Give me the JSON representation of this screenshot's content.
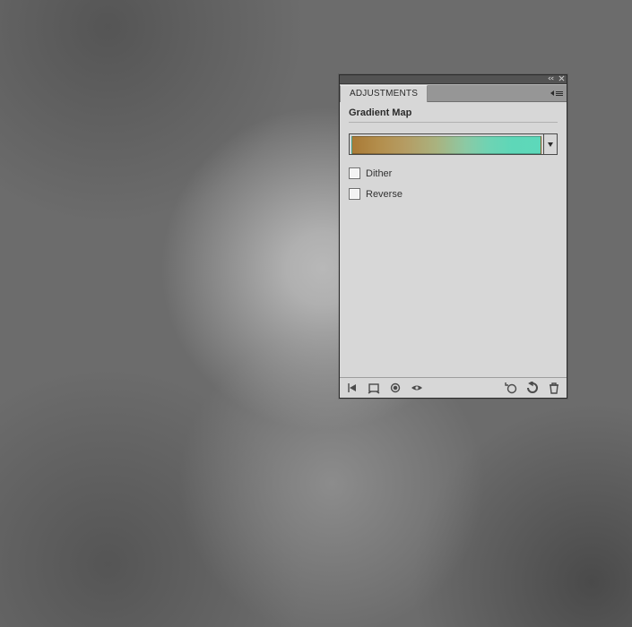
{
  "panel": {
    "tab_label": "ADJUSTMENTS",
    "heading": "Gradient Map",
    "checkboxes": {
      "dither": "Dither",
      "reverse": "Reverse"
    },
    "gradient": {
      "start_color": "#a97a36",
      "end_color": "#5dd8ba"
    }
  }
}
